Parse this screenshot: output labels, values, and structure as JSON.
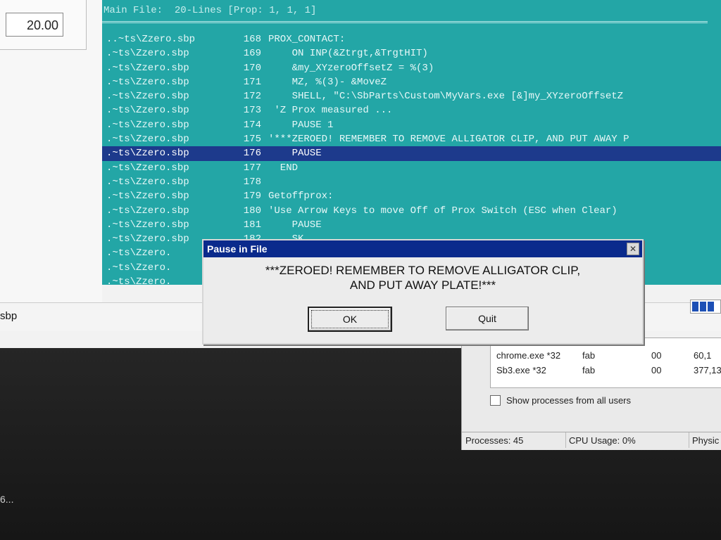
{
  "left_panel": {
    "value": "20.00"
  },
  "code_view": {
    "title": "Main File:  20-Lines [Prop: 1, 1, 1]",
    "lines": [
      {
        "file": "..~ts\\Zzero.sbp",
        "num": "168",
        "code": "PROX_CONTACT:"
      },
      {
        "file": ".~ts\\Zzero.sbp",
        "num": "169",
        "code": "    ON INP(&Ztrgt,&TrgtHIT)"
      },
      {
        "file": ".~ts\\Zzero.sbp",
        "num": "170",
        "code": "    &my_XYzeroOffsetZ = %(3)"
      },
      {
        "file": ".~ts\\Zzero.sbp",
        "num": "171",
        "code": "    MZ, %(3)- &MoveZ"
      },
      {
        "file": ".~ts\\Zzero.sbp",
        "num": "172",
        "code": "    SHELL, \"C:\\SbParts\\Custom\\MyVars.exe [&]my_XYzeroOffsetZ"
      },
      {
        "file": ".~ts\\Zzero.sbp",
        "num": "173",
        "code": " 'Z Prox measured ..."
      },
      {
        "file": ".~ts\\Zzero.sbp",
        "num": "174",
        "code": "    PAUSE 1"
      },
      {
        "file": ".~ts\\Zzero.sbp",
        "num": "175",
        "code": "'***ZEROED! REMEMBER TO REMOVE ALLIGATOR CLIP, AND PUT AWAY P"
      },
      {
        "file": ".~ts\\Zzero.sbp",
        "num": "176",
        "code": "    PAUSE"
      },
      {
        "file": ".~ts\\Zzero.sbp",
        "num": "177",
        "code": "  END"
      },
      {
        "file": ".~ts\\Zzero.sbp",
        "num": "178",
        "code": ""
      },
      {
        "file": ".~ts\\Zzero.sbp",
        "num": "179",
        "code": "Getoffprox:"
      },
      {
        "file": ".~ts\\Zzero.sbp",
        "num": "180",
        "code": "'Use Arrow Keys to move Off of Prox Switch (ESC when Clear)"
      },
      {
        "file": ".~ts\\Zzero.sbp",
        "num": "181",
        "code": "    PAUSE"
      },
      {
        "file": ".~ts\\Zzero.sbp",
        "num": "182",
        "code": "    SK"
      },
      {
        "file": ".~ts\\Zzero.",
        "num": "",
        "code": ""
      },
      {
        "file": ".~ts\\Zzero.",
        "num": "",
        "code": ""
      },
      {
        "file": ".~ts\\Zzero.",
        "num": "",
        "code": ""
      }
    ],
    "current_line_index": 8
  },
  "status_bar": {
    "text": "sbp"
  },
  "task_manager": {
    "processes": [
      {
        "name": "chrome.exe *32",
        "user": "fab",
        "cpu": "00",
        "mem": "60,1"
      },
      {
        "name": "Sb3.exe *32",
        "user": "fab",
        "cpu": "00",
        "mem": "377,13"
      }
    ],
    "show_all_label": "Show processes from all users",
    "status": {
      "processes": "Processes: 45",
      "cpu": "CPU Usage: 0%",
      "physical": "Physic"
    }
  },
  "dialog": {
    "title": "Pause in File",
    "message": "***ZEROED! REMEMBER TO REMOVE ALLIGATOR CLIP,\nAND PUT AWAY PLATE!***",
    "ok_label": "OK",
    "quit_label": "Quit"
  },
  "bottom_text": "6...",
  "colors": {
    "code_bg": "#23a6a6",
    "highlight": "#1d3a8c",
    "titlebar": "#0a2a8c"
  },
  "icons": {
    "close": "close-icon"
  }
}
